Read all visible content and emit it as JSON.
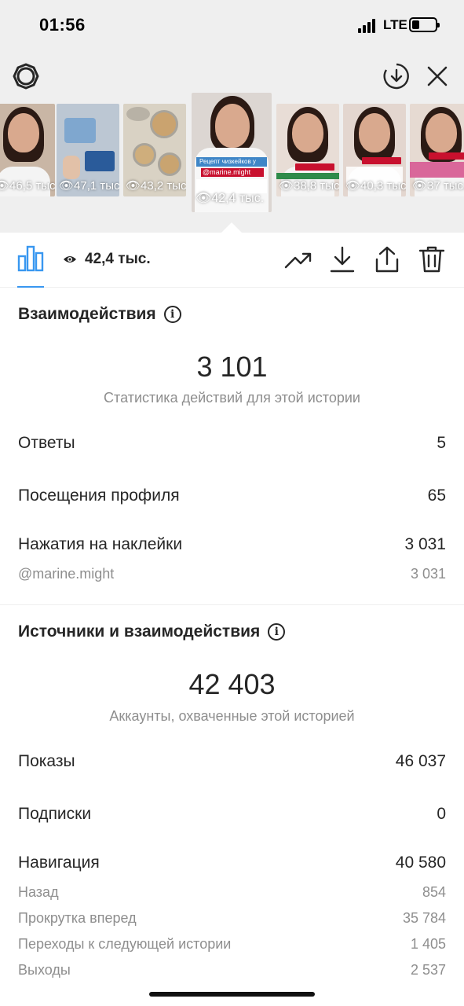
{
  "status_bar": {
    "time": "01:56",
    "network": "LTE",
    "battery_level": 0.25
  },
  "thumbnails": [
    {
      "views": "46,5 тыс.",
      "tint": "#c9b6a5"
    },
    {
      "views": "47,1 тыс.",
      "tint": "#bcc7d3"
    },
    {
      "views": "43,2 тыс.",
      "tint": "#d9d2c4"
    },
    {
      "views": "42,4 тыс.",
      "tint": "#dcd6d2",
      "active": true,
      "title": "Рецепт чизкейков у",
      "tag": "@marine.might"
    },
    {
      "views": "38,8 тыс.",
      "tint": "#e8ddd6"
    },
    {
      "views": "40,3 тыс.",
      "tint": "#e3d6cf"
    },
    {
      "views": "37 тыс.",
      "tint": "#e6dad2"
    }
  ],
  "toolbar": {
    "views_total": "42,4 тыс."
  },
  "interactions": {
    "title": "Взаимодействия",
    "total": "3 101",
    "caption": "Статистика действий для этой истории",
    "rows": [
      {
        "label": "Ответы",
        "value": "5"
      },
      {
        "label": "Посещения профиля",
        "value": "65"
      },
      {
        "label": "Нажатия на наклейки",
        "value": "3 031"
      }
    ],
    "sub_rows": [
      {
        "label": "@marine.might",
        "value": "3 031"
      }
    ]
  },
  "discovery": {
    "title": "Источники и взаимодействия",
    "total": "42 403",
    "caption": "Аккаунты, охваченные этой историей",
    "rows": [
      {
        "label": "Показы",
        "value": "46 037"
      },
      {
        "label": "Подписки",
        "value": "0"
      },
      {
        "label": "Навигация",
        "value": "40 580"
      }
    ],
    "navigation_rows": [
      {
        "label": "Назад",
        "value": "854"
      },
      {
        "label": "Прокрутка вперед",
        "value": "35 784"
      },
      {
        "label": "Переходы к следующей истории",
        "value": "1 405"
      },
      {
        "label": "Выходы",
        "value": "2 537"
      }
    ]
  },
  "icons": {
    "settings": "gear-icon",
    "download_circle": "download-circle-icon",
    "close": "close-icon",
    "chart": "bar-chart-icon",
    "eye": "eye-icon",
    "trend": "trend-up-icon",
    "download": "download-icon",
    "share": "share-icon",
    "delete": "trash-icon",
    "info": "info-icon"
  },
  "colors": {
    "accent": "#3897f0",
    "muted": "#8e8e8e",
    "text": "#262626"
  }
}
